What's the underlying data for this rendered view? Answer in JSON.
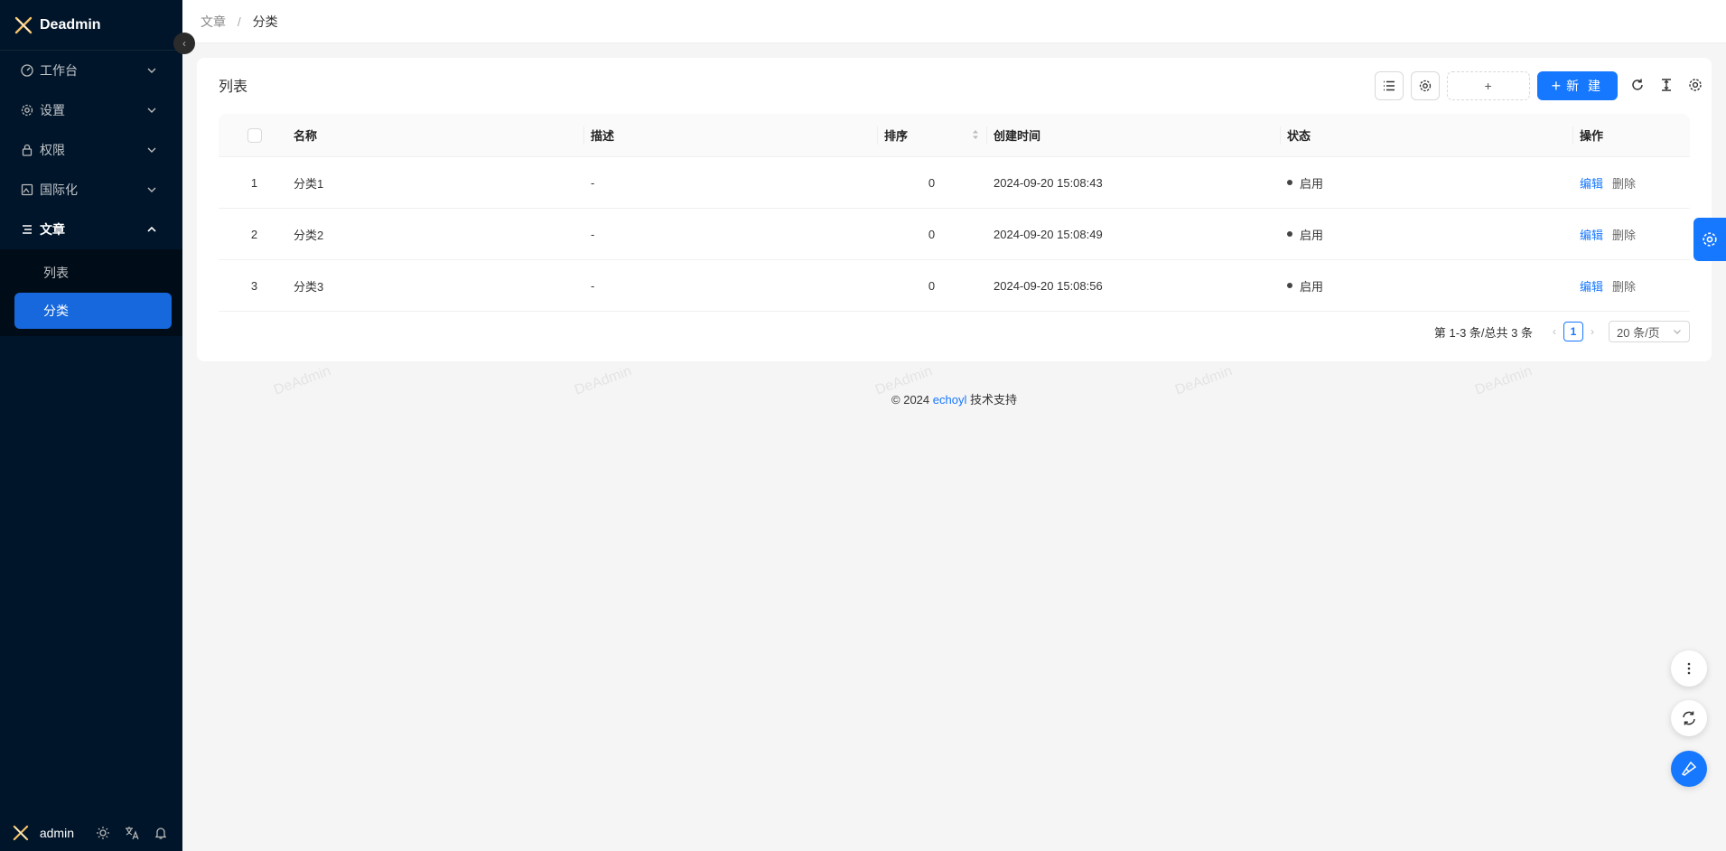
{
  "app": {
    "name": "Deadmin"
  },
  "sidebar": {
    "items": [
      {
        "label": "工作台",
        "icon": "dashboard-icon"
      },
      {
        "label": "设置",
        "icon": "gear-icon"
      },
      {
        "label": "权限",
        "icon": "lock-icon"
      },
      {
        "label": "国际化",
        "icon": "translate-image-icon"
      },
      {
        "label": "文章",
        "icon": "menu-lines-icon",
        "children": [
          {
            "label": "列表"
          },
          {
            "label": "分类",
            "active": true
          }
        ]
      }
    ],
    "footer": {
      "user": "admin"
    }
  },
  "breadcrumb": {
    "parent": "文章",
    "sep": "/",
    "current": "分类"
  },
  "card": {
    "title": "列表",
    "add_placeholder": "+",
    "new_button": "新 建"
  },
  "table": {
    "columns": [
      "名称",
      "描述",
      "排序",
      "创建时间",
      "状态",
      "操作"
    ],
    "rows": [
      {
        "index": "1",
        "name": "分类1",
        "desc": "-",
        "sort": "0",
        "created": "2024-09-20 15:08:43",
        "status": "启用"
      },
      {
        "index": "2",
        "name": "分类2",
        "desc": "-",
        "sort": "0",
        "created": "2024-09-20 15:08:49",
        "status": "启用"
      },
      {
        "index": "3",
        "name": "分类3",
        "desc": "-",
        "sort": "0",
        "created": "2024-09-20 15:08:56",
        "status": "启用"
      }
    ],
    "actions": {
      "edit": "编辑",
      "delete": "删除"
    }
  },
  "pagination": {
    "total_text": "第 1-3 条/总共 3 条",
    "current_page": "1",
    "page_size": "20 条/页"
  },
  "footer": {
    "prefix": "2024",
    "brand": "echoyl",
    "suffix": "技术支持"
  },
  "watermark": "DeAdmin",
  "colors": {
    "primary": "#1677ff",
    "sidebar_bg": "#001529"
  }
}
